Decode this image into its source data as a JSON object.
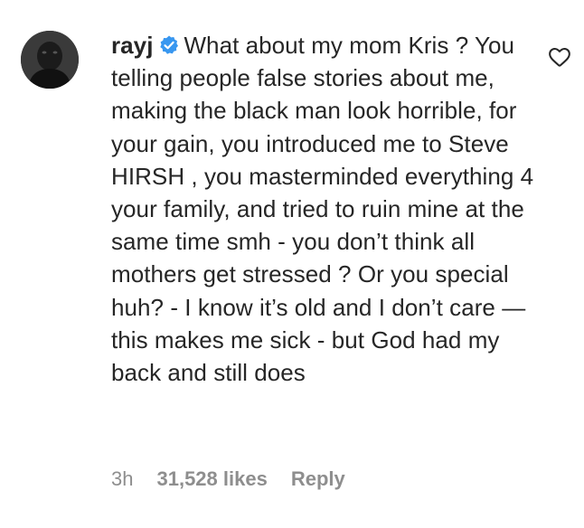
{
  "comment": {
    "username": "rayj",
    "verified": true,
    "text": "What about my mom Kris ? You telling people false stories about me, making the black man look horrible, for your gain, you introduced me to Steve HIRSH , you masterminded everything 4 your family, and tried to ruin mine at the same time smh - you don’t think all mothers get stressed ? Or you special huh? - I know it’s old and I don’t care — this makes me sick - but God had my back and still does",
    "time": "3h",
    "likes": "31,528 likes",
    "reply_label": "Reply"
  },
  "icons": {
    "avatar": "profile-photo",
    "verified": "verified-badge-icon",
    "like": "heart-outline-icon"
  },
  "colors": {
    "text": "#262626",
    "meta": "#8e8e8e",
    "verified_badge": "#3897f0"
  }
}
